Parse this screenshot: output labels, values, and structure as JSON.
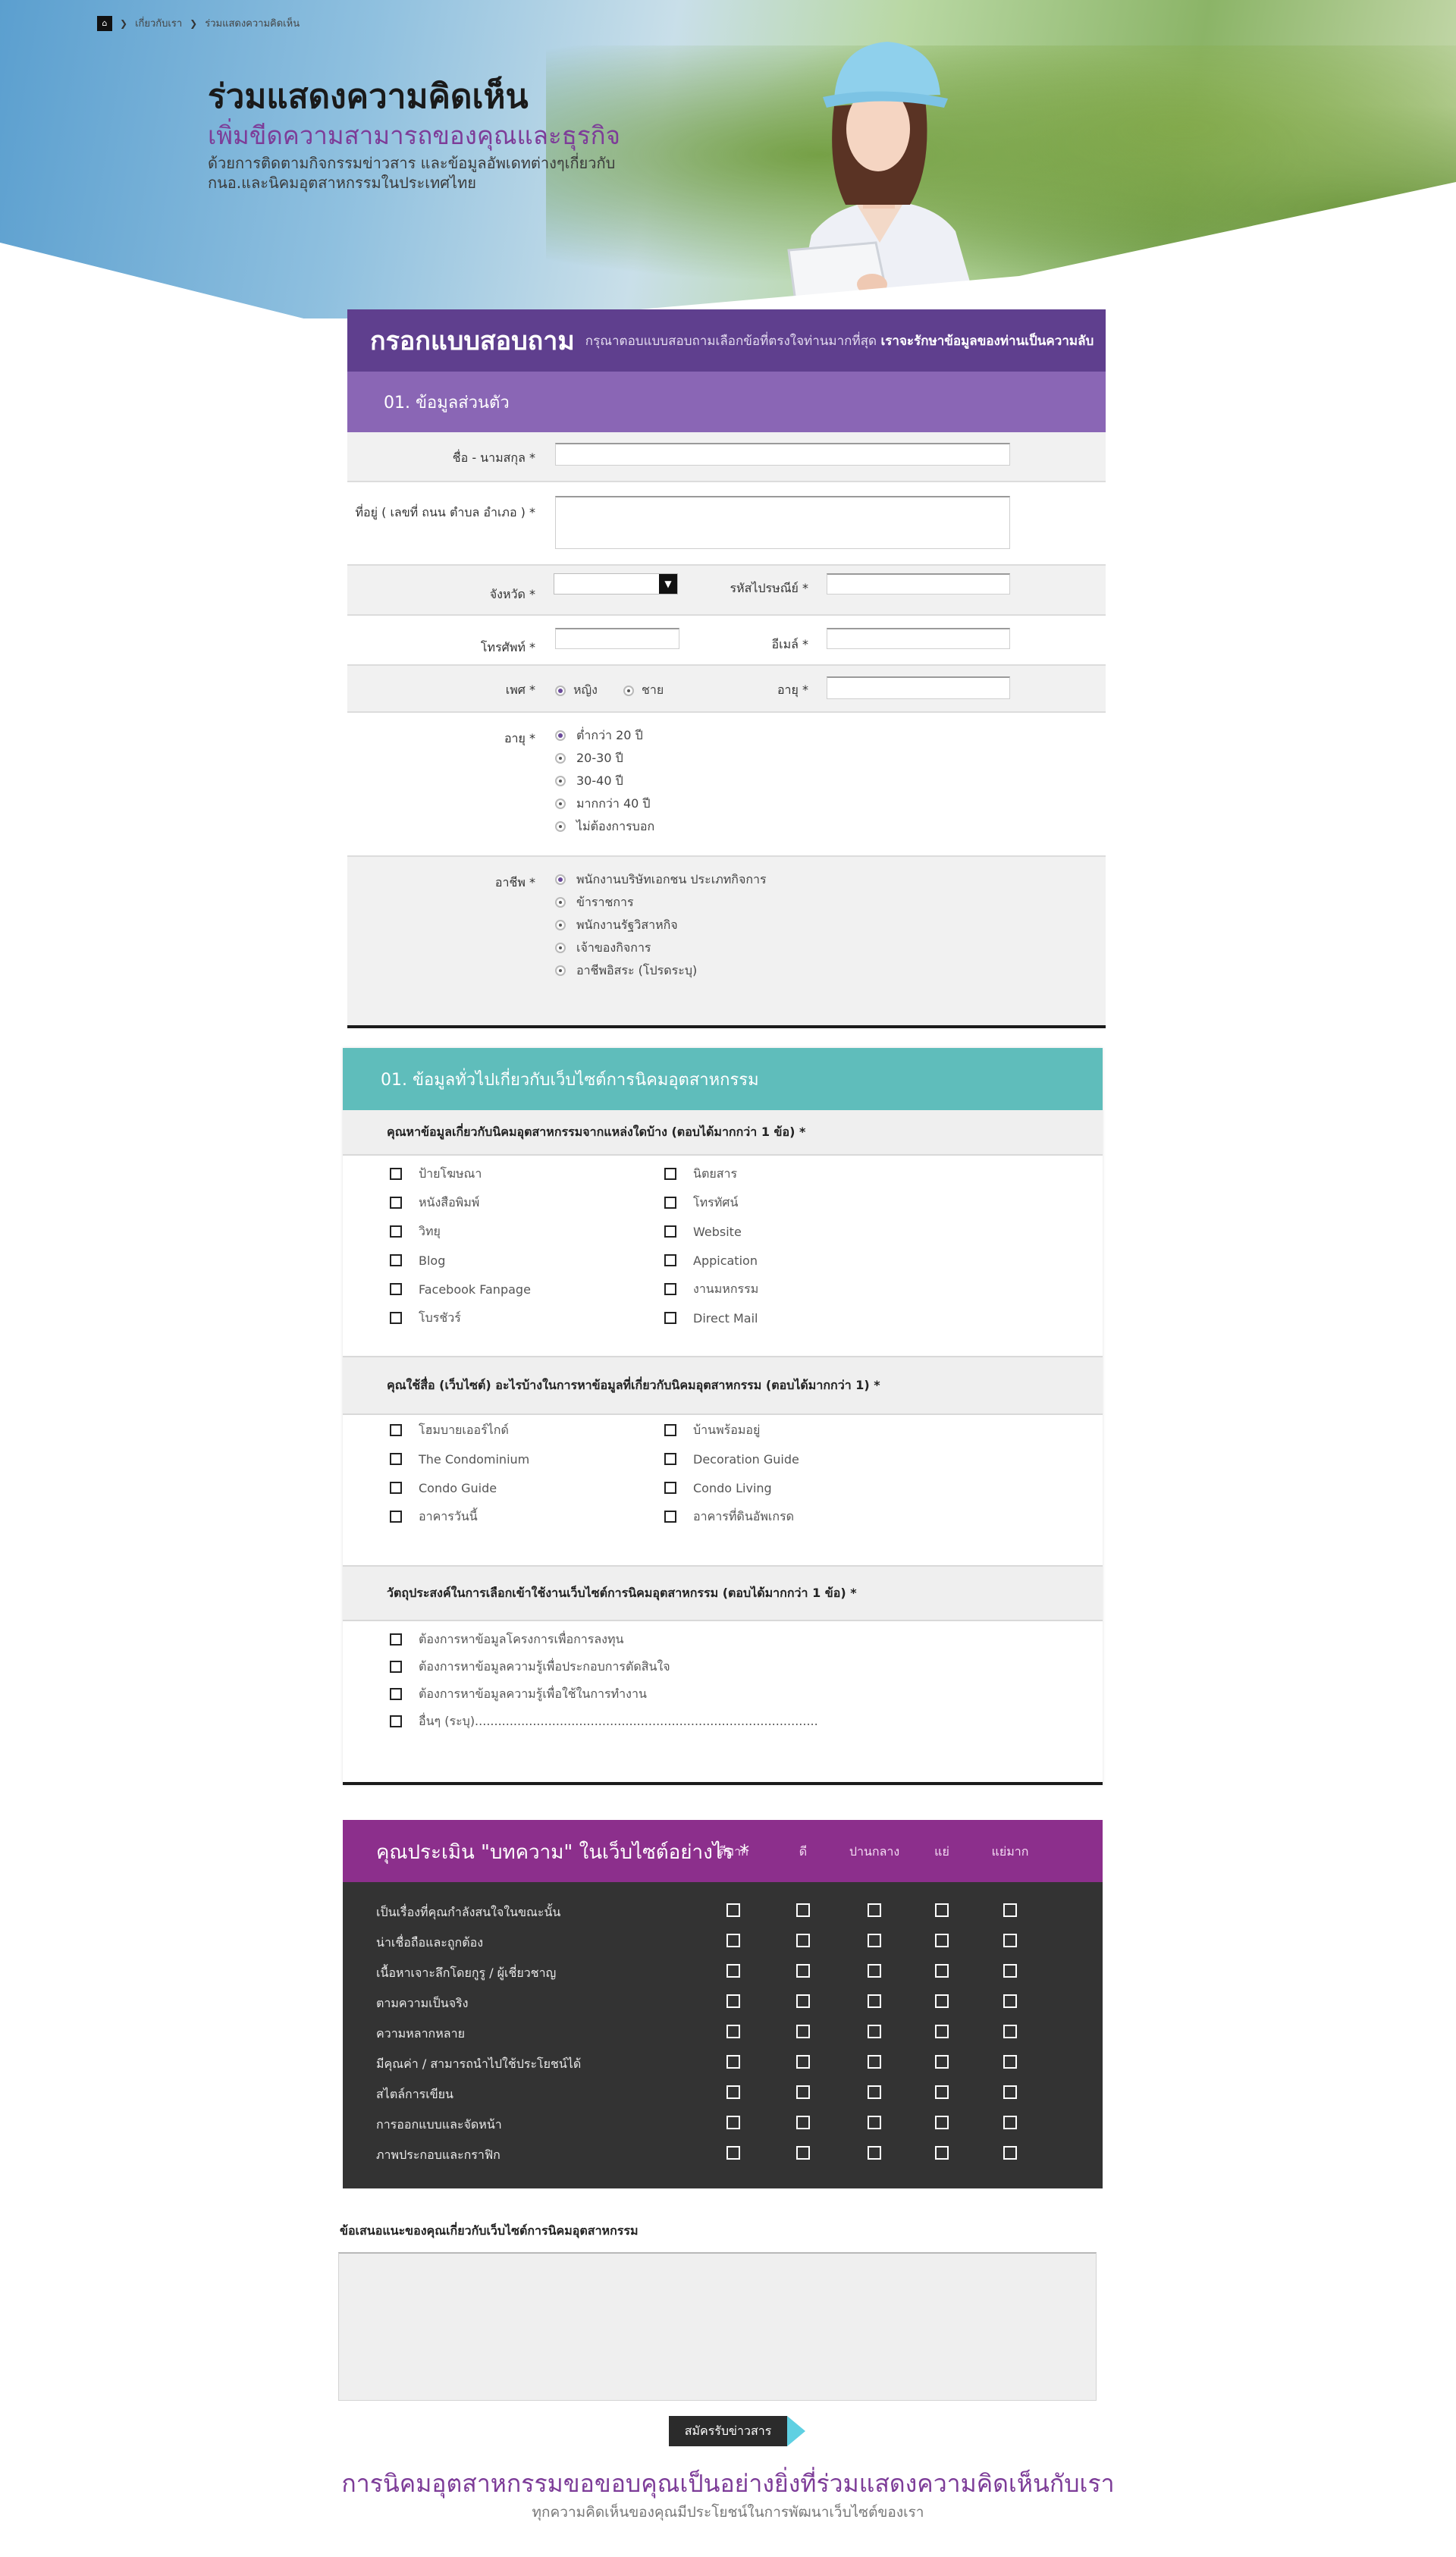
{
  "breadcrumb": {
    "home_icon": "home-icon",
    "items": [
      "เกี่ยวกับเรา",
      "ร่วมแสดงความคิดเห็น"
    ]
  },
  "hero": {
    "title": "ร่วมแสดงความคิดเห็น",
    "subtitle": "เพิ่มขีดความสามารถของคุณและธุรกิจ",
    "description": "ด้วยการติดตามกิจกรรมข่าวสาร และข้อมูลอัพเดทต่างๆเกี่ยวกับ กนอ.และนิคมอุตสาหกรรมในประเทศไทย"
  },
  "survey": {
    "title": "กรอกแบบสอบถาม",
    "note": "กรุณาตอบแบบสอบถามเลือกข้อที่ตรงใจท่านมากที่สุด",
    "note_bold": "เราจะรักษาข้อมูลของท่านเป็นความลับ"
  },
  "personal": {
    "section_title": "01. ข้อมูลส่วนตัว",
    "name_label": "ชื่อ - นามสกุล *",
    "address_label": "ที่อยู่ ( เลขที่ ถนน ตำบล อำเภอ ) *",
    "province_label": "จังหวัด *",
    "postcode_label": "รหัสไปรษณีย์ *",
    "phone_label": "โทรศัพท์ *",
    "email_label": "อีเมล์ *",
    "gender_label": "เพศ *",
    "gender_female": "หญิง",
    "gender_male": "ชาย",
    "age_inline_label": "อายุ *",
    "age_label": "อายุ *",
    "age_options": [
      "ต่ำกว่า 20 ปี",
      "20-30 ปี",
      "30-40 ปี",
      "มากกว่า 40 ปี",
      "ไม่ต้องการบอก"
    ],
    "job_label": "อาชีพ *",
    "job_options": [
      "พนักงานบริษัทเอกชน ประเภทกิจการ",
      "ข้าราชการ",
      "พนักงานรัฐวิสาหกิจ",
      "เจ้าของกิจการ",
      "อาชีพอิสระ (โปรดระบุ)"
    ]
  },
  "general": {
    "section_title": "01. ข้อมูลทั่วไปเกี่ยวกับเว็บไซต์การนิคมอุตสาหกรรม",
    "q1": "คุณหาข้อมูลเกี่ยวกับนิคมอุตสาหกรรมจากแหล่งใดบ้าง (ตอบได้มากกว่า 1 ข้อ) *",
    "q1_left": [
      "ป้ายโฆษณา",
      "หนังสือพิมพ์",
      "วิทยุ",
      "Blog",
      "Facebook Fanpage",
      "โบรชัวร์"
    ],
    "q1_right": [
      "นิตยสาร",
      "โทรทัศน์",
      "Website",
      "Appication",
      "งานมหกรรม",
      "Direct Mail"
    ],
    "q2": "คุณใช้สื่อ (เว็บไซต์) อะไรบ้างในการหาข้อมูลที่เกี่ยวกับนิคมอุตสาหกรรม (ตอบได้มากกว่า 1) *",
    "q2_left": [
      "โฮมบายเออร์ไกด์",
      "The Condominium",
      "Condo Guide",
      "อาคารวันนี้"
    ],
    "q2_right": [
      "บ้านพร้อมอยู่",
      "Decoration Guide",
      "Condo Living",
      "อาคารที่ดินอัพเกรด"
    ],
    "q3": "วัตถุประสงค์ในการเลือกเข้าใช้งานเว็บไซต์การนิคมอุตสาหกรรม (ตอบได้มากกว่า 1 ข้อ) *",
    "q3_options": [
      "ต้องการหาข้อมูลโครงการเพื่อการลงทุน",
      "ต้องการหาข้อมูลความรู้เพื่อประกอบการตัดสินใจ",
      "ต้องการหาข้อมูลความรู้เพื่อใช้ในการทำงาน",
      "อื่นๆ (ระบุ)........................................................................................."
    ]
  },
  "rating": {
    "title": "คุณประเมิน \"บทความ\" ในเว็บไซต์อย่างไร *",
    "columns": [
      "ดีมาก",
      "ดี",
      "ปานกลาง",
      "แย่",
      "แย่มาก"
    ],
    "rows": [
      "เป็นเรื่องที่คุณกำลังสนใจในขณะนั้น",
      "น่าเชื่อถือและถูกต้อง",
      "เนื้อหาเจาะลึกโดยกูรู / ผู้เชี่ยวชาญ",
      "ตามความเป็นจริง",
      "ความหลากหลาย",
      "มีคุณค่า / สามารถนำไปใช้ประโยชน์ได้",
      "สไตล์การเขียน",
      "การออกแบบและจัดหน้า",
      "ภาพประกอบและกราฟิก"
    ]
  },
  "suggestion": {
    "label": "ข้อเสนอแนะของคุณเกี่ยวกับเว็บไซต์การนิคมอุตสาหกรรม",
    "submit_label": "สมัครรับข่าวสาร"
  },
  "footer": {
    "thanks": "การนิคมอุตสาหกรรมขอขอบคุณเป็นอย่างยิ่งที่ร่วมแสดงความคิดเห็นกับเรา",
    "thanks_sub": "ทุกความคิดเห็นของคุณมีประโยชน์ในการพัฒนาเว็บไซต์ของเรา"
  },
  "colors": {
    "purple_dark": "#5f3f8e",
    "purple_light": "#8a66b5",
    "teal": "#5fbdbb",
    "magenta": "#8c2f8c",
    "accent_cyan": "#5fd0e2"
  }
}
